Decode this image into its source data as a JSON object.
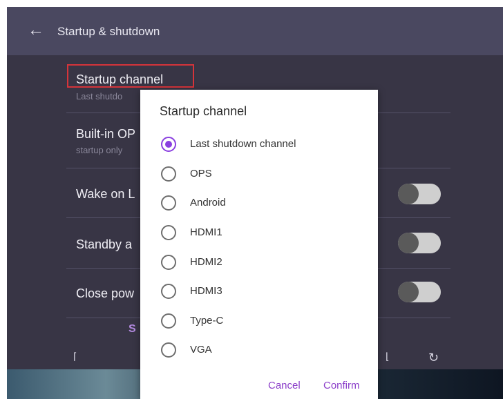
{
  "appbar": {
    "back_icon": "arrow-left-icon",
    "title": "Startup & shutdown"
  },
  "settings": [
    {
      "label": "Startup channel",
      "sub": "Last shutdo"
    },
    {
      "label": "Built-in OP",
      "sub": "startup only"
    },
    {
      "label": "Wake on L",
      "toggle": false
    },
    {
      "label": "Standby a",
      "toggle": false
    },
    {
      "label": "Close pow",
      "toggle": false
    }
  ],
  "peek_text": "S",
  "dialog": {
    "title": "Startup channel",
    "options": [
      {
        "label": "Last shutdown channel",
        "selected": true
      },
      {
        "label": "OPS",
        "selected": false
      },
      {
        "label": "Android",
        "selected": false
      },
      {
        "label": "HDMI1",
        "selected": false
      },
      {
        "label": "HDMI2",
        "selected": false
      },
      {
        "label": "HDMI3",
        "selected": false
      },
      {
        "label": "Type-C",
        "selected": false
      },
      {
        "label": "VGA",
        "selected": false
      }
    ],
    "cancel": "Cancel",
    "confirm": "Confirm"
  },
  "colors": {
    "accent": "#8a3fe0",
    "highlight": "#d6343a",
    "appbar": "#4a4860",
    "background": "#383545"
  }
}
